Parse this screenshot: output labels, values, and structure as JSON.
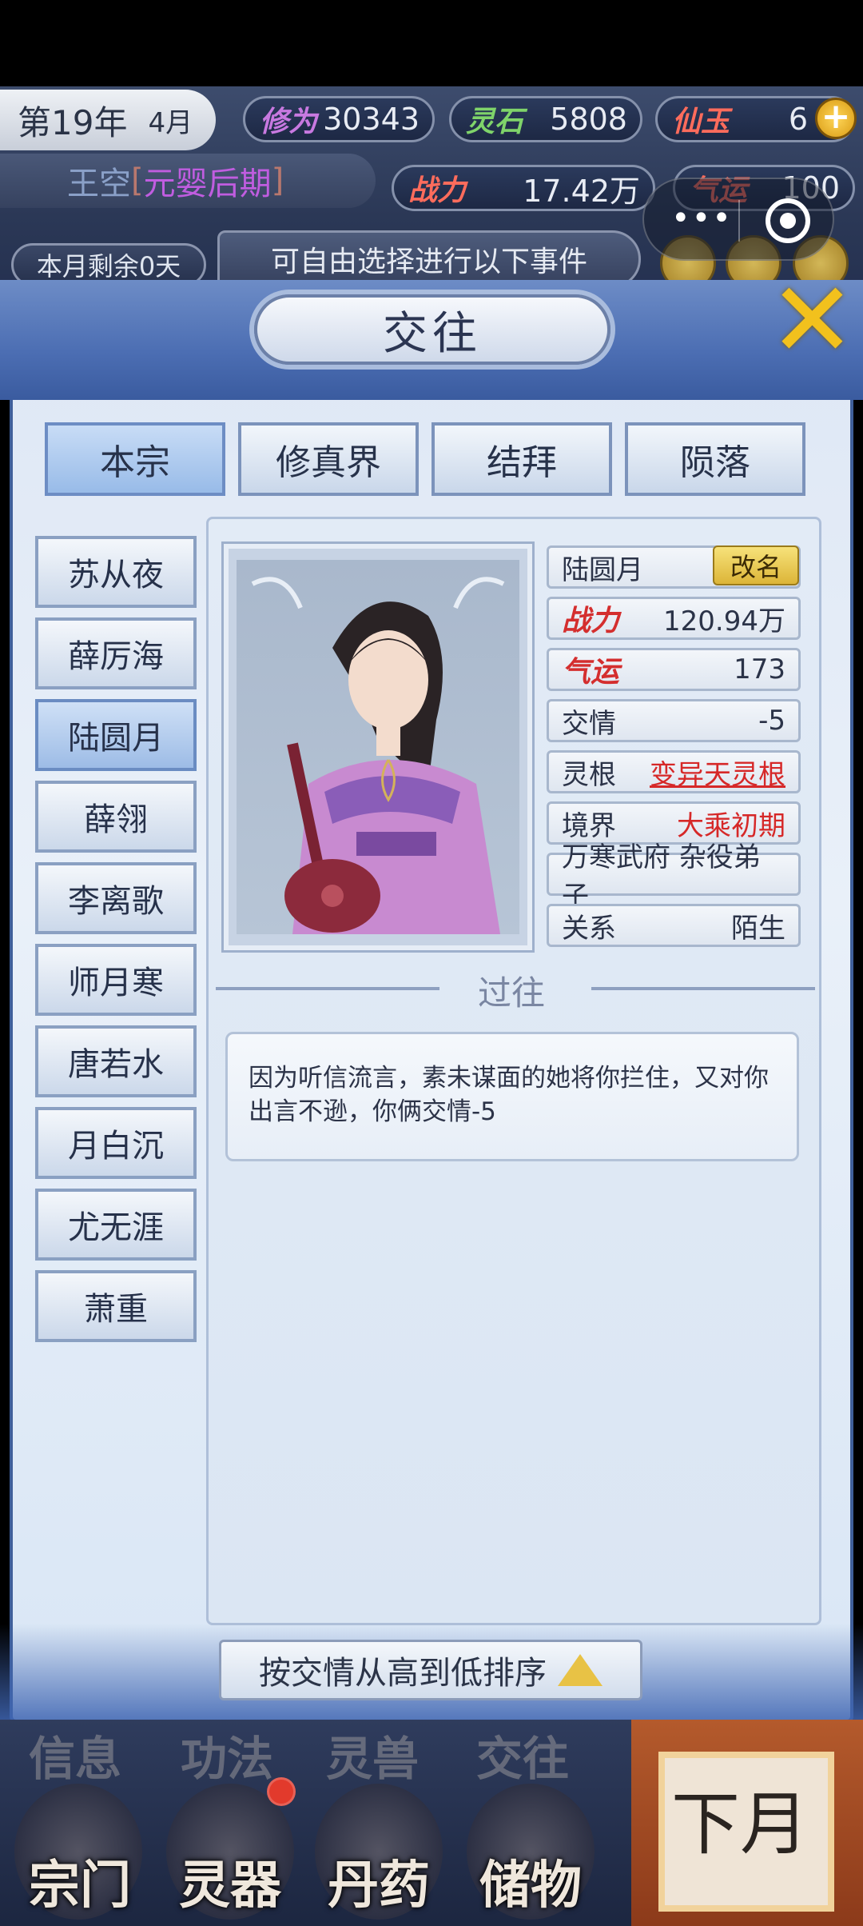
{
  "hud": {
    "year": "第19年",
    "month": "4月",
    "xiuwei_label": "修为",
    "xiuwei": "30343",
    "lingshi_label": "灵石",
    "lingshi": "5808",
    "xianyu_label": "仙玉",
    "xianyu": "6",
    "player_name": "王空",
    "bracket_left": "[",
    "realm": "元婴后期",
    "bracket_right": "]",
    "zhanli_label": "战力",
    "zhanli": "17.42万",
    "qiyun_label": "气运",
    "qiyun": "100",
    "remaining": "本月剩余0天",
    "event_hint": "可自由选择进行以下事件"
  },
  "dialog": {
    "title": "交往",
    "tabs": [
      "本宗",
      "修真界",
      "结拜",
      "陨落"
    ],
    "active_tab": 0
  },
  "characters": [
    "苏从夜",
    "薛厉海",
    "陆圆月",
    "薛翎",
    "李离歌",
    "师月寒",
    "唐若水",
    "月白沉",
    "尤无涯",
    "萧重"
  ],
  "active_character": 2,
  "detail": {
    "name": "陆圆月",
    "rename_label": "改名",
    "zhanli_label": "战力",
    "zhanli": "120.94万",
    "qiyun_label": "气运",
    "qiyun": "173",
    "jiaoqing_label": "交情",
    "jiaoqing": "-5",
    "linggen_label": "灵根",
    "linggen": "变异天灵根",
    "jingjie_label": "境界",
    "jingjie": "大乘初期",
    "sect": "万寒武府 杂役弟子",
    "guanxi_label": "关系",
    "guanxi": "陌生",
    "past_title": "过往",
    "past_text": "因为听信流言，素未谋面的她将你拦住，又对你出言不逊，你俩交情-5"
  },
  "sort_label": "按交情从高到低排序",
  "nav": {
    "top_labels": [
      "信息",
      "功法",
      "灵兽",
      "交往"
    ],
    "labels": [
      "宗门",
      "灵器",
      "丹药",
      "储物"
    ],
    "next_month": "下月"
  }
}
